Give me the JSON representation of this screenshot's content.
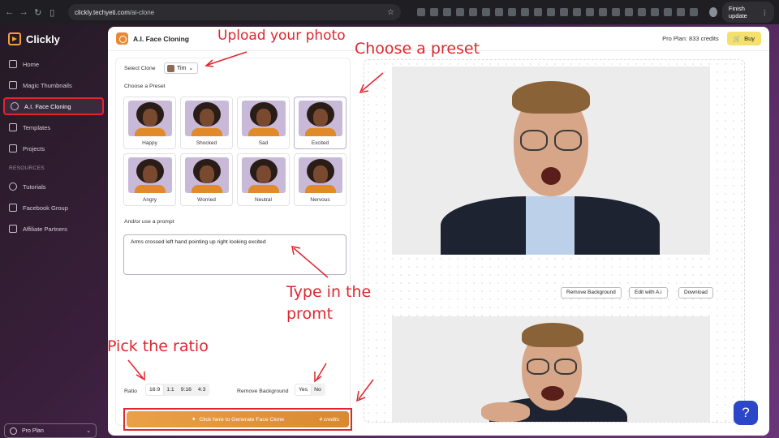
{
  "browser": {
    "url_host": "clickly.techyeti.com",
    "url_path": "/ai-clone",
    "finish_update": "Finish update"
  },
  "sidebar": {
    "brand": "Clickly",
    "items": [
      {
        "label": "Home",
        "icon": "home-icon"
      },
      {
        "label": "Magic Thumbnails",
        "icon": "wand-icon"
      },
      {
        "label": "A.I. Face Cloning",
        "icon": "face-icon"
      },
      {
        "label": "Templates",
        "icon": "templates-icon"
      },
      {
        "label": "Projects",
        "icon": "folder-icon"
      }
    ],
    "resources_label": "RESOURCES",
    "resources": [
      {
        "label": "Tutorials",
        "icon": "play-icon"
      },
      {
        "label": "Facebook Group",
        "icon": "facebook-icon"
      },
      {
        "label": "Affiliate Partners",
        "icon": "handshake-icon"
      }
    ],
    "plan": "Pro Plan"
  },
  "header": {
    "title": "A.I. Face Cloning",
    "credits": "Pro Plan: 833 credits",
    "buy": "Buy"
  },
  "form": {
    "select_clone_label": "Select Clone",
    "clone_value": "Tim",
    "choose_preset_label": "Choose a Preset",
    "presets": [
      "Happy",
      "Shocked",
      "Sad",
      "Excited",
      "Angry",
      "Worried",
      "Neutral",
      "Nervous"
    ],
    "prompt_label": "And/or use a prompt",
    "prompt_value": "Arms crossed left hand pointing up right looking excited",
    "ratio_label": "Ratio",
    "ratios": [
      "16:9",
      "1:1",
      "9:16",
      "4:3"
    ],
    "remove_bg_label": "Remove Background",
    "remove_bg_options": [
      "Yes",
      "No"
    ],
    "generate_label": "Click here to Generate Face Clone",
    "generate_cost": "4 credits"
  },
  "results": {
    "remove_background": "Remove Background",
    "edit_with_ai": "Edit with A.i",
    "download": "Download"
  },
  "help": "?",
  "annotations": {
    "upload": "Upload your photo",
    "preset": "Choose a preset",
    "prompt_line1": "Type in the",
    "prompt_line2": "promt",
    "ratio": "Pick the ratio"
  },
  "colors": {
    "accent": "#e68a3a",
    "annotation": "#e0262f",
    "buy": "#f4e06d",
    "help": "#2b47c8"
  }
}
